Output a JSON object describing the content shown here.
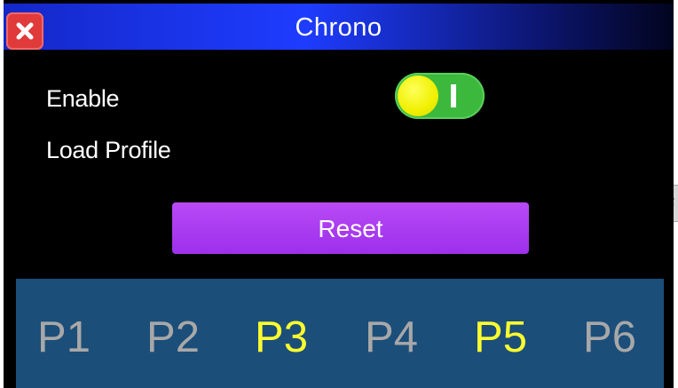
{
  "window": {
    "title": "Chrono"
  },
  "settings": {
    "enable_label": "Enable",
    "enable_state": "I",
    "load_profile_label": "Load Profile"
  },
  "actions": {
    "reset_label": "Reset"
  },
  "profiles": [
    {
      "label": "P1",
      "color": "#a8a8a8"
    },
    {
      "label": "P2",
      "color": "#a8a8a8"
    },
    {
      "label": "P3",
      "color": "#ffff2e"
    },
    {
      "label": "P4",
      "color": "#a8a8a8"
    },
    {
      "label": "P5",
      "color": "#ffff2e"
    },
    {
      "label": "P6",
      "color": "#a8a8a8"
    }
  ],
  "background_window": {
    "edge_text": "F"
  },
  "colors": {
    "toggle_on": "#3cb83c",
    "toggle_knob": "#f0f000",
    "reset_button": "#a43aef",
    "profile_bar": "#1c4e7a",
    "profile_active": "#ffff2e",
    "profile_inactive": "#a8a8a8"
  }
}
